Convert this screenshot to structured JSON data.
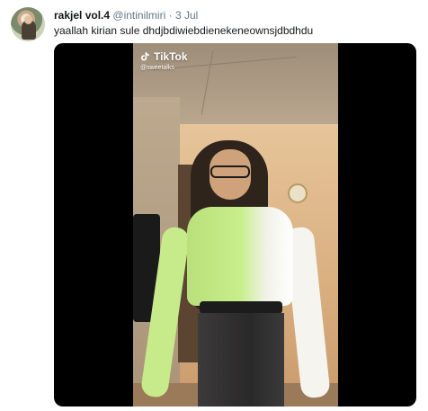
{
  "tweet": {
    "display_name": "rakjel vol.4",
    "handle": "@intinilmiri",
    "separator": "·",
    "date": "3 Jul",
    "text": "yaallah kirian sule dhdjbdiwiebdienekeneownsjdbdhdu"
  },
  "media": {
    "watermark_brand": "TikTok",
    "watermark_handle": "@sweetalks"
  },
  "colors": {
    "name": "#14171a",
    "secondary": "#657786",
    "media_background": "#000000"
  },
  "icons": {
    "avatar": "profile-photo",
    "watermark": "tiktok-note-icon"
  }
}
